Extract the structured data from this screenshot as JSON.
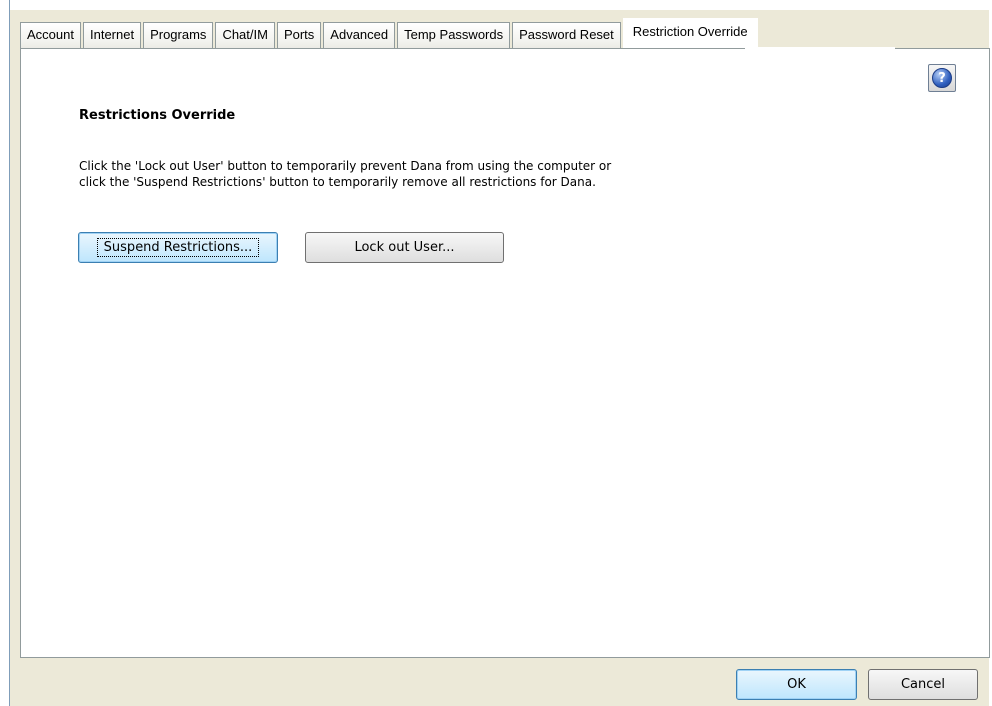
{
  "tabs": [
    {
      "label": "Account"
    },
    {
      "label": "Internet"
    },
    {
      "label": "Programs"
    },
    {
      "label": "Chat/IM"
    },
    {
      "label": "Ports"
    },
    {
      "label": "Advanced"
    },
    {
      "label": "Temp Passwords"
    },
    {
      "label": "Password Reset"
    },
    {
      "label": "Restriction Override",
      "active": true
    }
  ],
  "panel": {
    "title": "Restrictions Override",
    "description_line1": "Click the 'Lock out User' button to temporarily prevent Dana from using the computer or",
    "description_line2": "click the 'Suspend Restrictions' button to temporarily remove all restrictions for Dana.",
    "suspend_label": "Suspend Restrictions...",
    "lockout_label": "Lock out User...",
    "help_glyph": "?"
  },
  "footer": {
    "ok_label": "OK",
    "cancel_label": "Cancel"
  },
  "icons": {
    "help": "help-icon"
  },
  "colors": {
    "accent": "#bee6fd",
    "panel_bg": "#ffffff",
    "dialog_bg": "#ece9d8"
  }
}
